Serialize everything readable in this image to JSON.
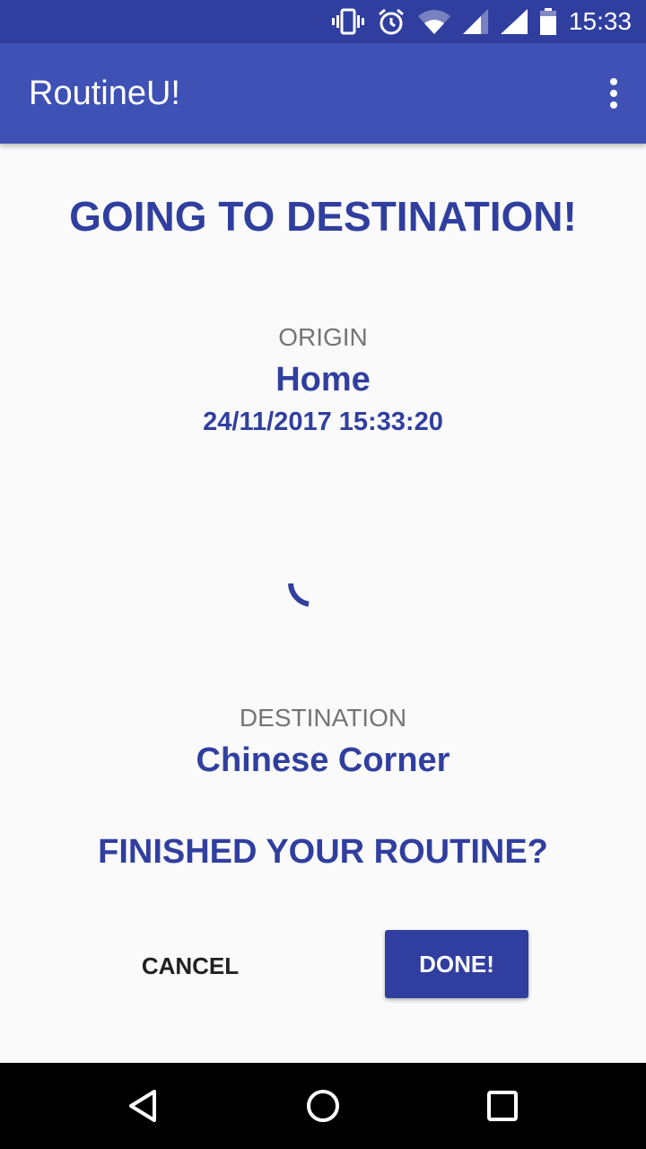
{
  "status_bar": {
    "time": "15:33",
    "icons": [
      "vibrate-icon",
      "alarm-icon",
      "wifi-icon",
      "signal-icon",
      "signal-icon",
      "battery-icon"
    ],
    "background": "#303f9f"
  },
  "app_bar": {
    "title": "RoutineU!",
    "menu_icon": "more-vert-icon",
    "background": "#3f51b5"
  },
  "main": {
    "title": "GOING TO DESTINATION!",
    "origin": {
      "label": "ORIGIN",
      "name": "Home",
      "timestamp": "24/11/2017 15:33:20"
    },
    "progress": {
      "icon": "loading-spinner-icon"
    },
    "destination": {
      "label": "DESTINATION",
      "name": "Chinese Corner"
    },
    "question": "FINISHED YOUR ROUTINE?",
    "actions": {
      "cancel_label": "CANCEL",
      "done_label": "DONE!"
    }
  },
  "nav_bar": {
    "icons": [
      "back-icon",
      "home-icon",
      "recents-icon"
    ]
  },
  "colors": {
    "accent": "#303f9f",
    "label_gray": "#757575",
    "background": "#fafafa"
  }
}
